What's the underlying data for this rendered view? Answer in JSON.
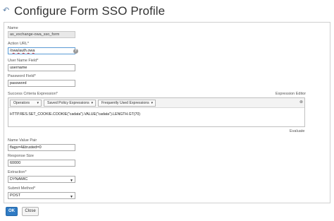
{
  "header": {
    "back_icon": "back-arrow-icon",
    "title": "Configure Form SSO Profile"
  },
  "form": {
    "name": {
      "label": "Name",
      "value": "as_exchange-owa_sso_form"
    },
    "action_url": {
      "label": "Action URL*",
      "value": "/owa/auth.owa",
      "help_icon": "?"
    },
    "username_field": {
      "label": "User Name Field*",
      "value": "username"
    },
    "password_field": {
      "label": "Password Field*",
      "value": "password"
    },
    "success_criteria": {
      "label": "Success Criteria Expression*",
      "editor_link": "Expression Editor",
      "toolbar": {
        "operators": "Operators",
        "saved_policy_expressions": "Saved Policy Expressions",
        "frequently_used_expressions": "Frequently Used Expressions"
      },
      "close_icon": "⊗",
      "expression": "HTTP.RES.SET_COOKIE.COOKIE(\"cadata\").VALUE(\"cadata\").LENGTH.GT(70)",
      "evaluate_link": "Evaluate"
    },
    "name_value_pair": {
      "label": "Name Value Pair",
      "value": "flags=4&trusted=0"
    },
    "response_size": {
      "label": "Response Size",
      "value": "60000"
    },
    "extraction": {
      "label": "Extraction*",
      "value": "DYNAMIC"
    },
    "submit_method": {
      "label": "Submit Method*",
      "value": "POST"
    }
  },
  "footer": {
    "ok_label": "OK",
    "close_label": "Close"
  },
  "colors": {
    "primary_button": "#2f7bc4",
    "focus_border": "#5b9bd5",
    "readonly_bg": "#e8e8e8"
  }
}
